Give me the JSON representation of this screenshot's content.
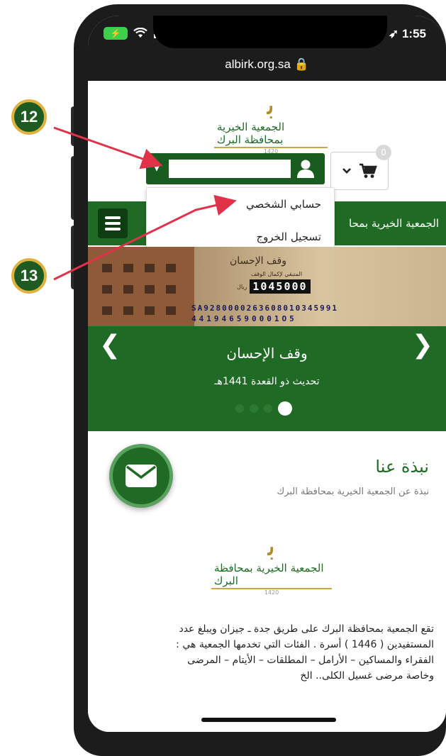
{
  "status_bar": {
    "battery": "⚡",
    "time": "1:55",
    "location_glyph": "➶"
  },
  "browser": {
    "url": "albirk.org.sa 🔒"
  },
  "header": {
    "logo_mark": "ﺑ",
    "logo_name": "الجمعية الخيرية بمحافظة البرك",
    "logo_year": "1420",
    "cart_count": "0",
    "user_field_value": ""
  },
  "dropdown": {
    "items": [
      {
        "label": "حسابي الشخصي"
      },
      {
        "label": "تسجيل الخروج"
      }
    ]
  },
  "green_bar": {
    "title": "الجمعية الخيرية بمحا"
  },
  "banner": {
    "title": "وقف الإحسان",
    "subtitle": "المتبقي لإكمال الوقف",
    "currency": "ريال",
    "amount": "1045000",
    "iban": "SA9280000263608010345991",
    "phone": "441946590001O5"
  },
  "slider": {
    "title": "وقف الإحسان",
    "subtitle": "تحديث ذو القعدة 1441هـ",
    "slides_total": 4,
    "active_slide": 4
  },
  "about": {
    "title": "نبذة عنا",
    "subtitle": "نبذة عن الجمعية الخيرية بمحافظة البرك",
    "body_lines": [
      "تقع الجمعية بمحافظة البرك على طريق جدة ـ جيزان ويبلغ عدد",
      "المستفيدين ( 1446 ) أسرة . الفئات التي تخدمها الجمعية هي :",
      "الفقراء والمساكين – الأرامل – المطلقات – الأيتام – المرضى",
      "وخاصة مرضى غسيل الكلى.. الخ"
    ]
  },
  "annotations": [
    {
      "number": "12"
    },
    {
      "number": "13"
    }
  ],
  "colors": {
    "brand_green": "#1f6a24",
    "dark_green": "#1a5c1f",
    "annotation_arrow": "#e0334a",
    "badge_border": "#e0b340"
  }
}
